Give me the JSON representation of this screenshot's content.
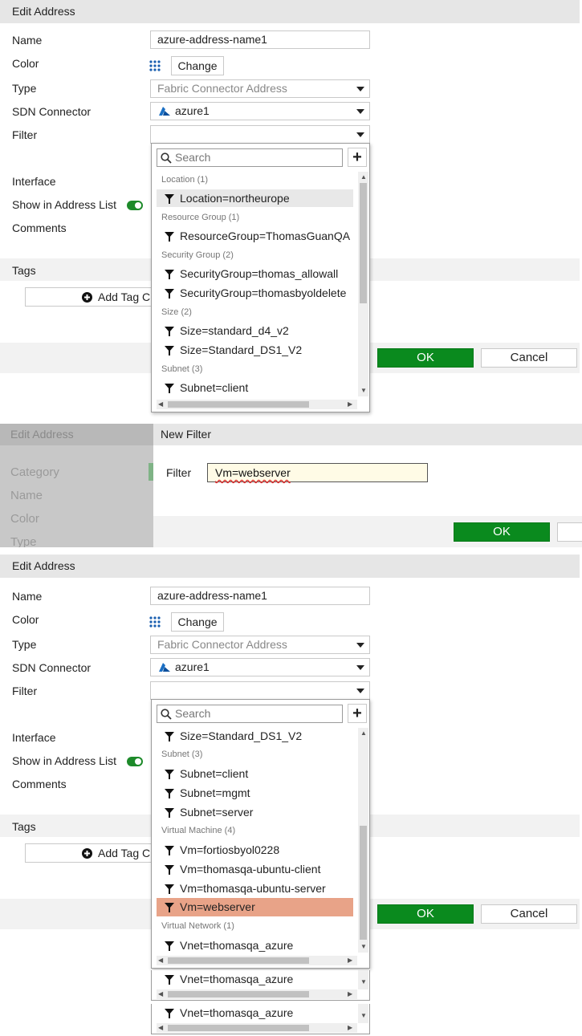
{
  "panel1": {
    "title": "Edit Address",
    "name_label": "Name",
    "name_value": "azure-address-name1",
    "color_label": "Color",
    "change_label": "Change",
    "type_label": "Type",
    "type_value": "Fabric Connector Address",
    "sdn_label": "SDN Connector",
    "sdn_value": "azure1",
    "filter_label": "Filter",
    "interface_label": "Interface",
    "show_label": "Show in Address List",
    "comments_label": "Comments",
    "tags_label": "Tags",
    "add_tag_label": "Add Tag C",
    "ok_label": "OK",
    "cancel_label": "Cancel",
    "search_placeholder": "Search",
    "plus_label": "+",
    "groups": [
      "Location (1)",
      "Resource Group (1)",
      "Security Group (2)",
      "Size (2)",
      "Subnet (3)"
    ],
    "items": [
      "Location=northeurope",
      "ResourceGroup=ThomasGuanQA",
      "SecurityGroup=thomas_allowall",
      "SecurityGroup=thomasbyoldelete",
      "Size=standard_d4_v2",
      "Size=Standard_DS1_V2",
      "Subnet=client"
    ]
  },
  "panel2": {
    "bg_title": "Edit Address",
    "bg_labels": [
      "Category",
      "Name",
      "Color",
      "Type"
    ],
    "title": "New Filter",
    "filter_label": "Filter",
    "filter_value": "Vm=webserver",
    "ok_label": "OK"
  },
  "panel3": {
    "title": "Edit Address",
    "name_label": "Name",
    "name_value": "azure-address-name1",
    "color_label": "Color",
    "change_label": "Change",
    "type_label": "Type",
    "type_value": "Fabric Connector Address",
    "sdn_label": "SDN Connector",
    "sdn_value": "azure1",
    "filter_label": "Filter",
    "interface_label": "Interface",
    "show_label": "Show in Address List",
    "comments_label": "Comments",
    "tags_label": "Tags",
    "add_tag_label": "Add Tag C",
    "ok_label": "OK",
    "cancel_label": "Cancel",
    "search_placeholder": "Search",
    "plus_label": "+",
    "groups": [
      "Subnet (3)",
      "Virtual Machine (4)",
      "Virtual Network (1)"
    ],
    "items": [
      "Size=Standard_DS1_V2",
      "Subnet=client",
      "Subnet=mgmt",
      "Subnet=server",
      "Vm=fortiosbyol0228",
      "Vm=thomasqa-ubuntu-client",
      "Vm=thomasqa-ubuntu-server",
      "Vm=webserver",
      "Vnet=thomasqa_azure"
    ]
  },
  "extra": {
    "items": [
      "Vnet=thomasqa_azure",
      "Vnet=thomasqa_azure"
    ]
  },
  "colors": {
    "ok_green": "#0a8a1e",
    "selected_row": "#e8a388",
    "azure_blue": "#1a6fc4",
    "toggle_green": "#1d8a2a"
  }
}
